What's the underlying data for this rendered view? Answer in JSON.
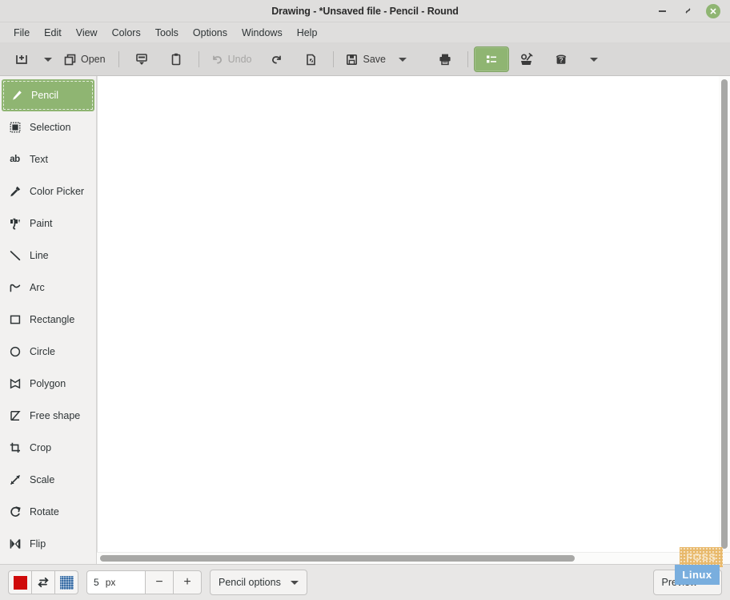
{
  "window": {
    "title": "Drawing - *Unsaved file - Pencil - Round",
    "controls": {
      "minimize": "minimize-button",
      "maximize": "restore-button",
      "close": "close-button"
    },
    "accent_green": "#8fb572",
    "titlebar_bg": "#dfdedd",
    "toolbar_bg": "#d9d8d7",
    "sidebar_bg": "#f2f1f0",
    "canvas_bg": "#ffffff"
  },
  "menubar": {
    "items": [
      {
        "label": "File"
      },
      {
        "label": "Edit"
      },
      {
        "label": "View"
      },
      {
        "label": "Colors"
      },
      {
        "label": "Tools"
      },
      {
        "label": "Options"
      },
      {
        "label": "Windows"
      },
      {
        "label": "Help"
      }
    ]
  },
  "toolbar": {
    "new_image_icon": "new-image-icon",
    "new_image_caret": "chevron-down-icon",
    "open_label": "Open",
    "open_icon": "open-folder-icon",
    "import_icon": "import-screenshot-icon",
    "paste_icon": "clipboard-paste-icon",
    "undo_label": "Undo",
    "undo_icon": "undo-arrow-icon",
    "undo_enabled": false,
    "redo_icon": "redo-arrow-icon",
    "document_icon": "document-tool-icon",
    "save_label": "Save",
    "save_icon": "floppy-save-icon",
    "save_caret": "chevron-down-icon",
    "print_icon": "printer-icon",
    "sidebar_toggle_icon": "tools-list-icon",
    "sidebar_toggle_active": true,
    "preferences_icon": "tools-preferences-icon",
    "help_icon": "help-question-icon",
    "overflow_caret": "chevron-down-icon"
  },
  "sidebar": {
    "selected": "Pencil",
    "items": [
      {
        "label": "Pencil",
        "icon": "pencil-icon"
      },
      {
        "label": "Selection",
        "icon": "selection-icon"
      },
      {
        "label": "Text",
        "icon": "text-ab-icon"
      },
      {
        "label": "Color Picker",
        "icon": "color-picker-icon"
      },
      {
        "label": "Paint",
        "icon": "paint-bucket-icon"
      },
      {
        "label": "Line",
        "icon": "line-icon"
      },
      {
        "label": "Arc",
        "icon": "arc-icon"
      },
      {
        "label": "Rectangle",
        "icon": "rectangle-icon"
      },
      {
        "label": "Circle",
        "icon": "circle-icon"
      },
      {
        "label": "Polygon",
        "icon": "polygon-icon"
      },
      {
        "label": "Free shape",
        "icon": "free-shape-icon"
      },
      {
        "label": "Crop",
        "icon": "crop-icon"
      },
      {
        "label": "Scale",
        "icon": "scale-icon"
      },
      {
        "label": "Rotate",
        "icon": "rotate-icon"
      },
      {
        "label": "Flip",
        "icon": "flip-icon"
      }
    ]
  },
  "canvas": {
    "background": "#ffffff",
    "vertical_scrollbar": "vertical-scrollbar",
    "horizontal_scrollbar": "horizontal-scrollbar"
  },
  "bottombar": {
    "main_color": "#cf0a0a",
    "alt_color": "#3a6ea5",
    "swap_icon": "swap-colors-icon",
    "size_value": "5",
    "size_unit": "px",
    "decrease_label": "−",
    "increase_label": "+",
    "tool_options_label": "Pencil options",
    "tool_options_caret": "chevron-down-icon",
    "preview_label": "Preview",
    "preview_caret": "chevron-down-icon"
  },
  "watermark": {
    "line1": "FOSS",
    "line2": "Linux"
  }
}
